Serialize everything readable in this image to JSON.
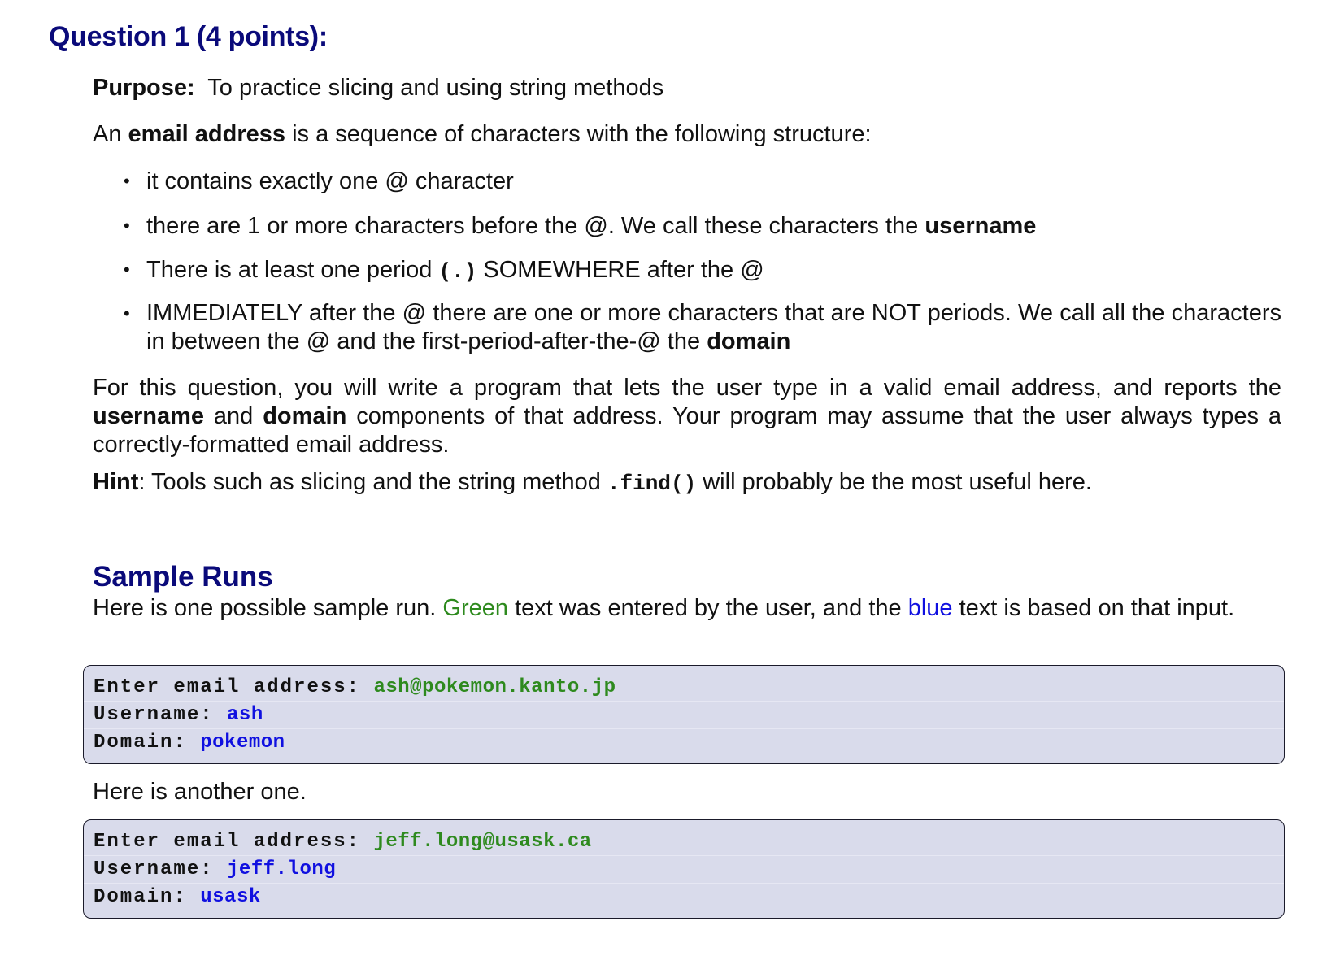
{
  "question": {
    "title": "Question 1 (4 points):"
  },
  "purpose": {
    "label": "Purpose:",
    "text": "To practice slicing and using string methods"
  },
  "intro": {
    "pre": "An",
    "bold": "email address",
    "post": "is a sequence of characters with the following structure:"
  },
  "bullets": [
    {
      "text": "it contains exactly one @ character"
    },
    {
      "pre": "there are 1 or more characters before the @. We call these characters the",
      "bold": "username"
    },
    {
      "pre": "There is at least one period",
      "code": "(.)",
      "post": "SOMEWHERE after the @"
    },
    {
      "pre": "IMMEDIATELY after the @ there are one or more characters that are NOT periods.  We call all the characters in between the @ and the first-period-after-the-@ the",
      "bold": "domain"
    }
  ],
  "task": {
    "pre": "For this question, you will write a program that lets the user type in a valid email address, and reports the",
    "bold1": "username",
    "mid": "and",
    "bold2": "domain",
    "post": "components of that address. Your program may assume that the user always types a correctly-formatted email address."
  },
  "hint": {
    "label": "Hint",
    "pre": ": Tools such as slicing and the string method",
    "code": ".find()",
    "post": "will probably be the most useful here."
  },
  "sample_runs": {
    "heading": "Sample Runs",
    "intro_pre": "Here is one possible sample run.",
    "green_word": "Green",
    "intro_mid": "text was entered by the user, and the",
    "blue_word": "blue",
    "intro_post": "text is based on that input.",
    "between": "Here is another one.",
    "run1": {
      "prompt": "Enter email address:",
      "input": "ash@pokemon.kanto.jp",
      "user_label": "Username:",
      "user_value": "ash",
      "domain_label": "Domain:",
      "domain_value": "pokemon"
    },
    "run2": {
      "prompt": "Enter email address:",
      "input": "jeff.long@usask.ca",
      "user_label": "Username:",
      "user_value": "jeff.long",
      "domain_label": "Domain:",
      "domain_value": "usask"
    }
  },
  "colors": {
    "heading": "#0a0a7a",
    "user_input": "#2e8a1e",
    "program_output": "#1010e0",
    "code_bg": "#d9dbeb"
  }
}
